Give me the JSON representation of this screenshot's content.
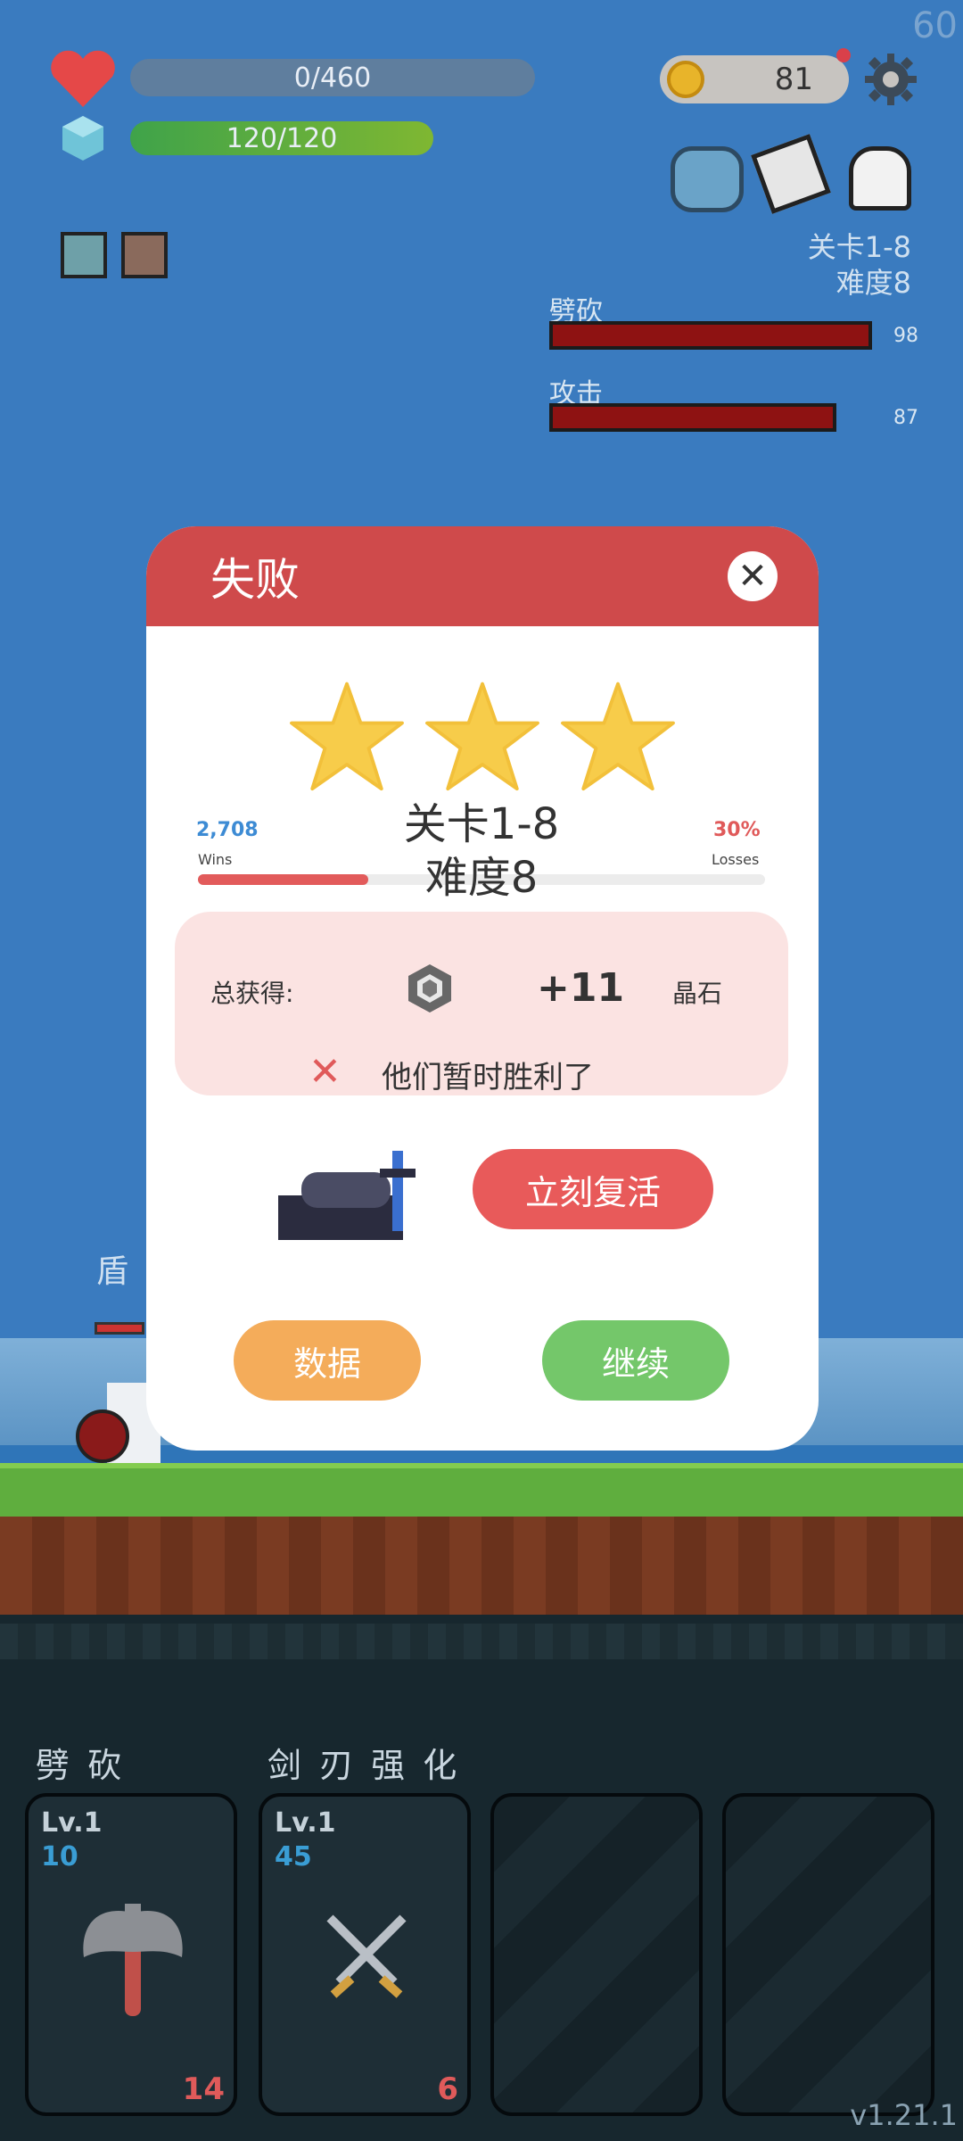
{
  "hud": {
    "fps": "60",
    "hp_text": "0/460",
    "mana_text": "120/120",
    "coins": "81"
  },
  "enemy": {
    "stage": "关卡1-8",
    "difficulty": "难度8",
    "skills": [
      {
        "name": "劈砍",
        "value": "98",
        "fill": 0.98
      },
      {
        "name": "攻击",
        "value": "87",
        "fill": 0.87
      }
    ]
  },
  "dialog": {
    "title": "失败",
    "close_icon": "close-icon",
    "stars": 3,
    "stage": "关卡1-8",
    "difficulty": "难度8",
    "wins_value": "2,708",
    "wins_label": "Wins",
    "losses_value": "30%",
    "losses_label": "Losses",
    "loss_fraction": 0.3,
    "reward_label": "总获得:",
    "reward_amount": "+11",
    "reward_name": "晶石",
    "fail_message": "他们暂时胜利了",
    "revive_label": "立刻复活",
    "stats_label": "数据",
    "continue_label": "继续"
  },
  "bottom": {
    "slots": [
      {
        "title": "劈 砍",
        "lv": "Lv.1",
        "level_num": "10",
        "cost": "14",
        "icon": "axe-icon"
      },
      {
        "title": "剑 刃 强 化",
        "lv": "Lv.1",
        "level_num": "45",
        "cost": "6",
        "icon": "crossed-swords-icon"
      },
      {
        "title": "",
        "lv": "",
        "level_num": "",
        "cost": "",
        "icon": ""
      },
      {
        "title": "",
        "lv": "",
        "level_num": "",
        "cost": "",
        "icon": ""
      }
    ],
    "version": "v1.21.1"
  },
  "colors": {
    "dialog_header": "#cf4a4b",
    "revive": "#e85a5a",
    "stats": "#f4ac5a",
    "continue": "#74c76a"
  }
}
